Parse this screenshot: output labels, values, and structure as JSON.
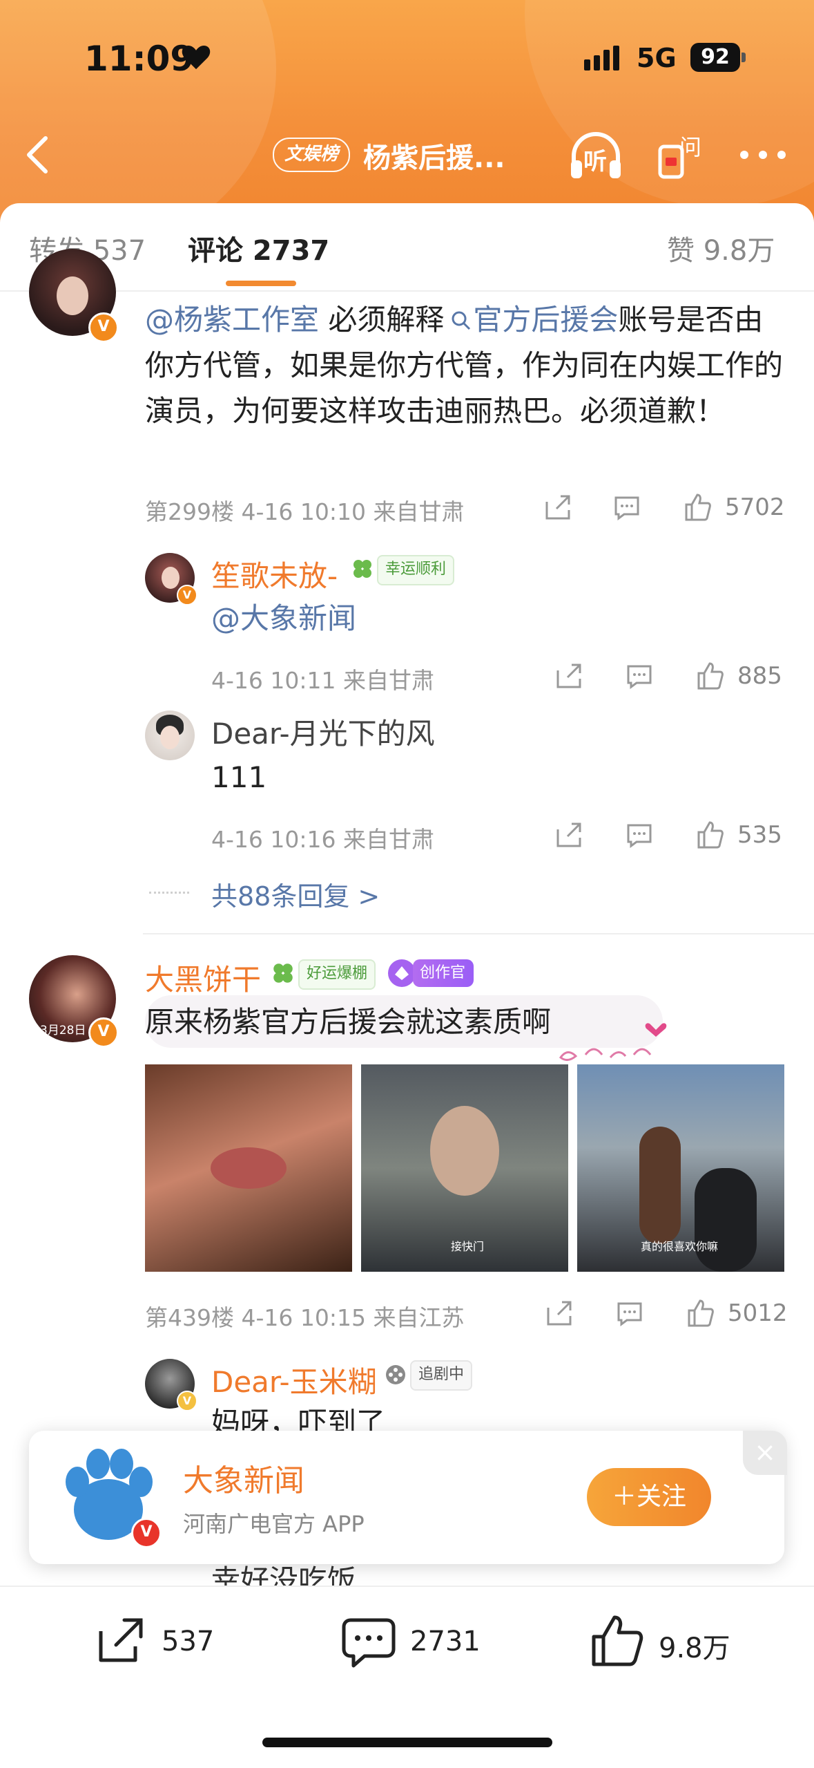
{
  "status": {
    "time": "11:09",
    "network": "5G",
    "battery": "92"
  },
  "nav": {
    "tag": "文娱榜",
    "title": "杨紫后援...",
    "listen_label": "听",
    "ask_label": "问"
  },
  "tabs": [
    {
      "label": "转发 537"
    },
    {
      "label": "评论 2737"
    },
    {
      "label": "赞 9.8万"
    }
  ],
  "comment1": {
    "text_parts": [
      "@杨紫工作室",
      " 必须解释",
      "官方后援会",
      "账号是否由你方代管，如果是你方代管，作为同在内娱工作的演员，为何要这样攻击迪丽热巴。必须道歉！"
    ],
    "meta": "第299楼 4-16 10:10 来自甘肃",
    "likes": "5702",
    "replies": [
      {
        "name": "笙歌未放-",
        "badge": "幸运顺利",
        "text": "@大象新闻",
        "meta": "4-16 10:11 来自甘肃",
        "likes": "885"
      },
      {
        "name": "Dear-月光下的风",
        "text": "111",
        "meta": "4-16 10:16 来自甘肃",
        "likes": "535"
      }
    ],
    "more_replies": "共88条回复 >"
  },
  "comment2": {
    "name": "大黑饼干",
    "badge_green": "好运爆棚",
    "badge_purple": "创作官",
    "avatar_text": "3月28日",
    "text": "原来杨紫官方后援会就这素质啊",
    "photo_captions": [
      "",
      "接快门",
      "真的很喜欢你嘛"
    ],
    "meta": "第439楼 4-16 10:15 来自江苏",
    "likes": "5012",
    "reply": {
      "name": "Dear-玉米糊",
      "badge": "追剧中",
      "text": "妈呀，吓到了"
    },
    "hidden_reply_text": "幸好没吃饭"
  },
  "promo": {
    "name": "大象新闻",
    "desc": "河南广电官方 APP",
    "follow": "＋关注"
  },
  "bottom": {
    "reposts": "537",
    "comments": "2731",
    "likes": "9.8万"
  },
  "colors": {
    "accent": "#f28a30",
    "link": "#5877a8",
    "username": "#f07a2c"
  }
}
